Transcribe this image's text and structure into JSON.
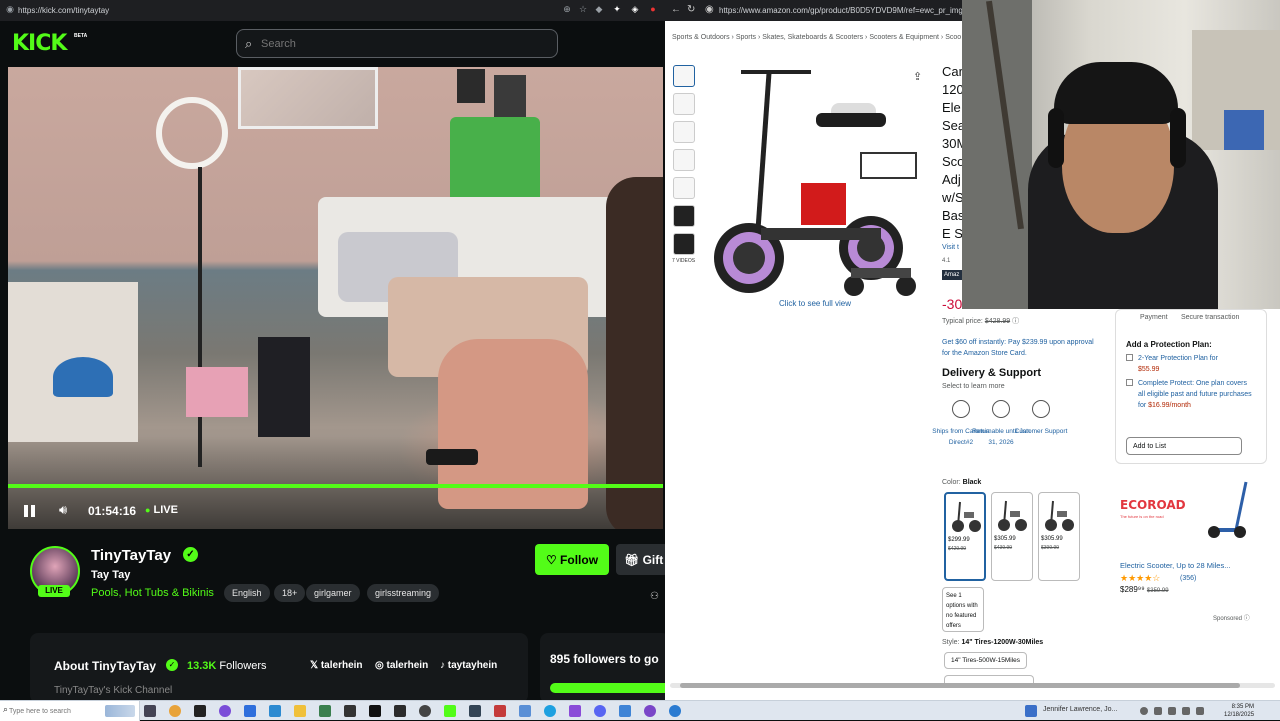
{
  "kick": {
    "url": "https://kick.com/tinytaytay",
    "logo": "KICK",
    "logo_badge": "BETA",
    "search_placeholder": "Search",
    "player": {
      "elapsed": "01:54:16",
      "live_label": "LIVE",
      "progress_fraction": 1.0
    },
    "channel": {
      "avatar_live": "LIVE",
      "name": "TinyTayTay",
      "handle": "Tay Tay",
      "category": "Pools, Hot Tubs & Bikinis",
      "tags": [
        "English",
        "18+",
        "girlgamer",
        "girlsstreaming"
      ],
      "follow_label": "Follow",
      "gift_label": "Gift"
    },
    "about": {
      "title": "About TinyTayTay",
      "followers_count": "13.3K",
      "followers_label": "Followers",
      "socials": [
        "talerhein",
        "talerhein",
        "taytayhein"
      ],
      "subtitle": "TinyTayTay's Kick Channel"
    },
    "goal": {
      "text": "895 followers to go"
    },
    "accent_color": "#53fc18"
  },
  "amazon": {
    "url": "https://www.amazon.com/gp/product/B0D5YDVD9M/ref=ewc_pr_img_17th=",
    "breadcrumb": [
      "Sports & Outdoors",
      "Sports",
      "Skates, Skateboards & Scooters",
      "Scooters & Equipment",
      "Scoo"
    ],
    "thumb_videos_label": "7 VIDEOS",
    "click_full_view": "Click to see full view",
    "title_fragments": [
      "Car",
      "120",
      "Ele",
      "Sea",
      "30M",
      "Sco",
      "Adj",
      "w/S",
      "Bas",
      "E S"
    ],
    "visit_fragment": "Visit t",
    "rating_fragment": "4.1",
    "badge_fragment": "Amaz",
    "discount_fragment": "-30",
    "typical_label": "Typical price:",
    "typical_price": "$428.99",
    "card_offer": "Get $60 off instantly: Pay $239.99 upon approval for the Amazon Store Card.",
    "delivery_title": "Delivery & Support",
    "learn_more": "Select to learn more",
    "delivery_items": [
      {
        "label": "Ships from Caromia Direct#2",
        "icon": "truck-icon"
      },
      {
        "label": "Returnable until Jan 31, 2026",
        "icon": "return-icon"
      },
      {
        "label": "Customer Support",
        "icon": "headset-icon"
      }
    ],
    "buybox": {
      "payment": "Payment",
      "secure": "Secure transaction",
      "plan_title": "Add a Protection Plan:",
      "plans": [
        {
          "label": "2-Year Protection Plan for",
          "price": "$55.99"
        },
        {
          "label": "Complete Protect: One plan covers all eligible past and future purchases for",
          "price": "$16.99/month"
        }
      ],
      "add_to_list": "Add to List"
    },
    "color_label": "Color:",
    "color_value": "Black",
    "swatches": [
      {
        "price": "$299.99",
        "old": "$429.99"
      },
      {
        "price": "$305.99",
        "old": "$439.99"
      },
      {
        "price": "$305.99",
        "old": "$399.99"
      }
    ],
    "see_options": "See 1 options with no featured offers",
    "style_label": "Style:",
    "style_value": "14\" Tires-1200W-30Miles",
    "style_option": "14\" Tires-500W-15Miles",
    "ad": {
      "brand": "ECOROAD",
      "brand_sub": "The future is on the road",
      "title": "Electric Scooter, Up to 28 Miles...",
      "stars": "★★★★☆",
      "reviews": "(356)",
      "price": "$289⁹⁹",
      "old_price": "$359.99"
    },
    "sponsored": "Sponsored"
  },
  "taskbar": {
    "search_placeholder": "Type here to search",
    "notification": "Jennifer Lawrence, Jo...",
    "time": "8:35 PM",
    "date": "12/18/2025"
  }
}
